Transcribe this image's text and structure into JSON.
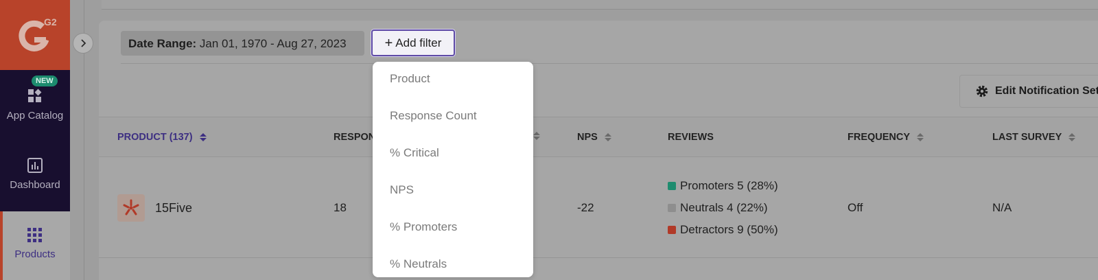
{
  "sidebar": {
    "brand": "G2",
    "badge": "NEW",
    "items": [
      {
        "label": "App Catalog",
        "icon": "app-catalog-icon"
      },
      {
        "label": "Dashboard",
        "icon": "dashboard-icon"
      },
      {
        "label": "Products",
        "icon": "grid-icon"
      }
    ]
  },
  "filters": {
    "date_label": "Date Range:",
    "date_value": "Jan 01, 1970 - Aug 27, 2023",
    "add_filter_label": "Add filter",
    "add_filter_icon": "+"
  },
  "dropdown": {
    "options": [
      "Product",
      "Response Count",
      "% Critical",
      "NPS",
      "% Promoters",
      "% Neutrals"
    ]
  },
  "toolbar": {
    "edit_notification_label": "Edit Notification Set"
  },
  "table": {
    "columns": [
      "PRODUCT (137)",
      "RESPON",
      "NPS",
      "REVIEWS",
      "FREQUENCY",
      "LAST SURVEY"
    ],
    "rows": [
      {
        "product": "15Five",
        "responses": "18",
        "nps": "-22",
        "reviews": [
          {
            "label": "Promoters 5 (28%)",
            "color": "#1f8c6f"
          },
          {
            "label": "Neutrals 4 (22%)",
            "color": "#8e8e8e"
          },
          {
            "label": "Detractors 9 (50%)",
            "color": "#b13a28"
          }
        ],
        "frequency": "Off",
        "last_survey": "N/A"
      }
    ]
  },
  "colors": {
    "brand": "#b8432a",
    "accent": "#5e4aa6",
    "nav_dark": "#180f2f"
  }
}
